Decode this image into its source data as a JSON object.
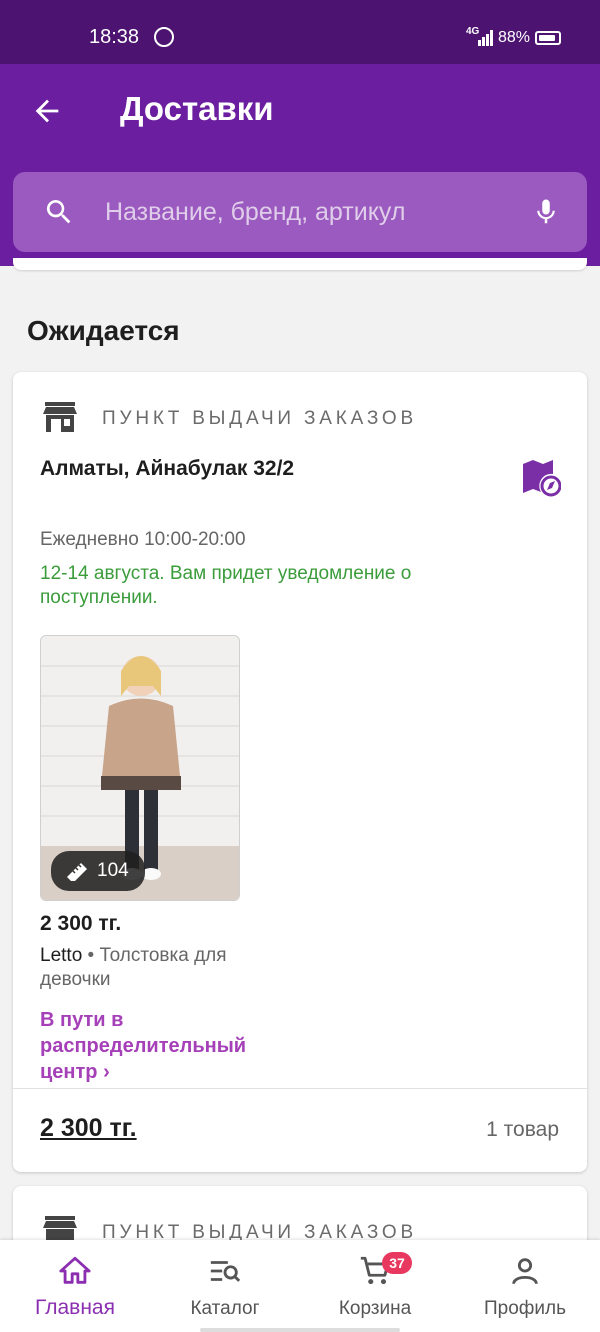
{
  "status_bar": {
    "time": "18:38",
    "network": "4G",
    "battery": "88%"
  },
  "header": {
    "title": "Доставки"
  },
  "search": {
    "placeholder": "Название, бренд, артикул"
  },
  "section": {
    "title": "Ожидается"
  },
  "delivery": {
    "point_label": "ПУНКТ ВЫДАЧИ ЗАКАЗОВ",
    "address": "Алматы, Айнабулак 32/2",
    "hours": "Ежедневно 10:00-20:00",
    "eta": "12-14 августа. Вам придет уведомление о поступлении.",
    "item": {
      "size": "104",
      "price": "2 300 тг.",
      "brand": "Letto",
      "name": "Толстовка для девочки",
      "status": "В пути в распределительный центр ›"
    },
    "total": "2 300 тг.",
    "count": "1 товар"
  },
  "delivery2": {
    "point_label": "ПУНКТ ВЫДАЧИ ЗАКАЗОВ"
  },
  "nav": {
    "home": "Главная",
    "catalog": "Каталог",
    "cart": "Корзина",
    "cart_badge": "37",
    "profile": "Профиль"
  },
  "colors": {
    "accent": "#6b1ea0",
    "status_bar": "#4c1470",
    "eta": "#3a9c3a",
    "status_link": "#a540b8"
  }
}
